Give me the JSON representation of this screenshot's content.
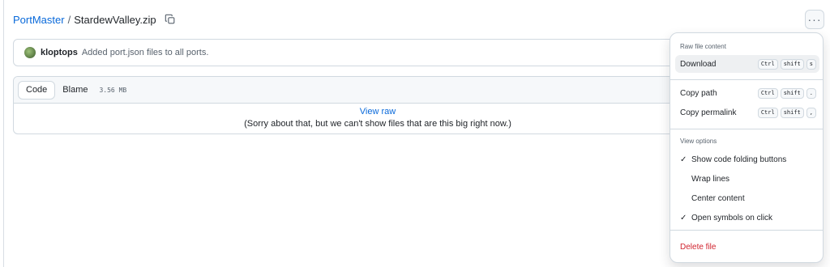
{
  "breadcrumb": {
    "repo": "PortMaster",
    "separator": "/",
    "file": "StardewValley.zip"
  },
  "header": {
    "more_label": "···"
  },
  "commit": {
    "author": "kloptops",
    "message": "Added port.json files to all ports."
  },
  "file_view": {
    "tabs": [
      {
        "label": "Code",
        "active": true
      },
      {
        "label": "Blame",
        "active": false
      }
    ],
    "size": "3.56 MB",
    "view_raw": "View raw",
    "too_big_message": "(Sorry about that, but we can't show files that are this big right now.)"
  },
  "menu": {
    "raw_group_label": "Raw file content",
    "download": {
      "label": "Download",
      "keys": [
        "Ctrl",
        "shift",
        "s"
      ]
    },
    "copy_path": {
      "label": "Copy path",
      "keys": [
        "Ctrl",
        "shift",
        "."
      ]
    },
    "copy_permalink": {
      "label": "Copy permalink",
      "keys": [
        "Ctrl",
        "shift",
        ","
      ]
    },
    "view_options_label": "View options",
    "view_options": [
      {
        "label": "Show code folding buttons",
        "checked": true
      },
      {
        "label": "Wrap lines",
        "checked": false
      },
      {
        "label": "Center content",
        "checked": false
      },
      {
        "label": "Open symbols on click",
        "checked": true
      }
    ],
    "delete_file": "Delete file"
  },
  "colors": {
    "link": "#0969da",
    "danger": "#d1242f",
    "border": "#d1d9e0"
  }
}
